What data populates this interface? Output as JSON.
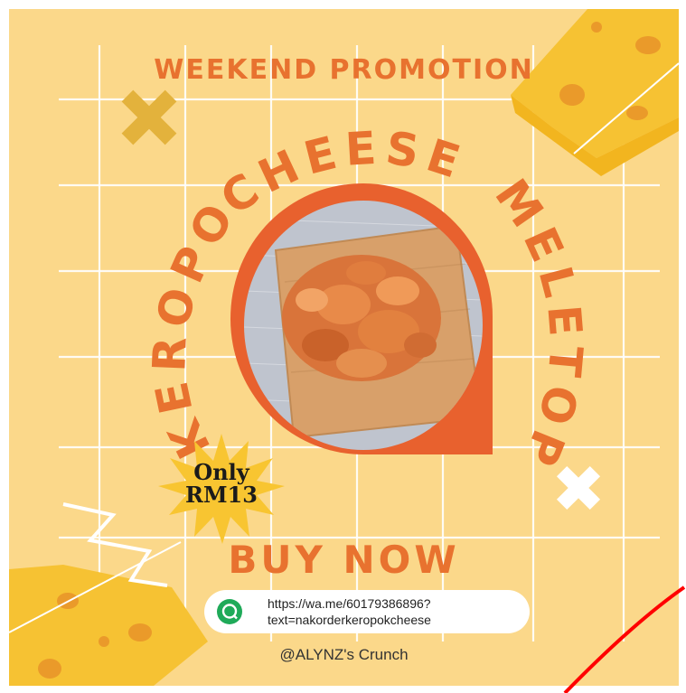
{
  "poster": {
    "headline": "WEEKEND PROMOTION",
    "product_name_left": "KEROPOK",
    "product_name_top": "CHEESE",
    "product_name_right": "MELETOP",
    "price_line1": "Only",
    "price_line2": "RM13",
    "cta": "BUY NOW",
    "link_line1": "https://wa.me/60179386896?",
    "link_line2": "text=nakorderkeropokcheese",
    "handle": "@ALYNZ's Crunch"
  },
  "colors": {
    "background": "#fbd88a",
    "accent_orange": "#e8722f",
    "cheese_yellow": "#f6c233",
    "cheese_hole": "#ea9a2a",
    "link_icon": "#1faa59",
    "annotation_stroke": "#ff0000"
  },
  "icons": {
    "link": "whatsapp-icon",
    "decor_cross": "cross-mark-icon"
  }
}
